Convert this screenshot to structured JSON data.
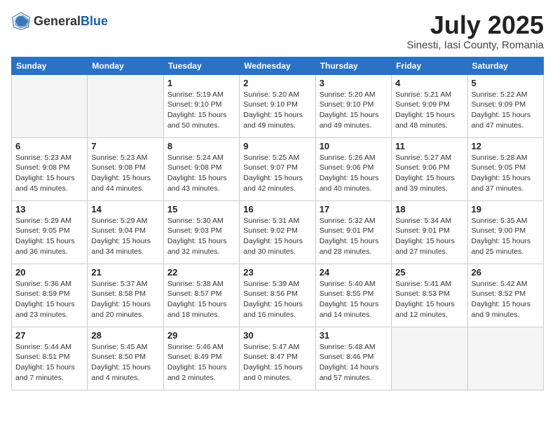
{
  "header": {
    "logo_general": "General",
    "logo_blue": "Blue",
    "month_year": "July 2025",
    "location": "Sinesti, Iasi County, Romania"
  },
  "days_of_week": [
    "Sunday",
    "Monday",
    "Tuesday",
    "Wednesday",
    "Thursday",
    "Friday",
    "Saturday"
  ],
  "weeks": [
    [
      {
        "day": "",
        "info": ""
      },
      {
        "day": "",
        "info": ""
      },
      {
        "day": "1",
        "info": "Sunrise: 5:19 AM\nSunset: 9:10 PM\nDaylight: 15 hours and 50 minutes."
      },
      {
        "day": "2",
        "info": "Sunrise: 5:20 AM\nSunset: 9:10 PM\nDaylight: 15 hours and 49 minutes."
      },
      {
        "day": "3",
        "info": "Sunrise: 5:20 AM\nSunset: 9:10 PM\nDaylight: 15 hours and 49 minutes."
      },
      {
        "day": "4",
        "info": "Sunrise: 5:21 AM\nSunset: 9:09 PM\nDaylight: 15 hours and 48 minutes."
      },
      {
        "day": "5",
        "info": "Sunrise: 5:22 AM\nSunset: 9:09 PM\nDaylight: 15 hours and 47 minutes."
      }
    ],
    [
      {
        "day": "6",
        "info": "Sunrise: 5:23 AM\nSunset: 9:08 PM\nDaylight: 15 hours and 45 minutes."
      },
      {
        "day": "7",
        "info": "Sunrise: 5:23 AM\nSunset: 9:08 PM\nDaylight: 15 hours and 44 minutes."
      },
      {
        "day": "8",
        "info": "Sunrise: 5:24 AM\nSunset: 9:08 PM\nDaylight: 15 hours and 43 minutes."
      },
      {
        "day": "9",
        "info": "Sunrise: 5:25 AM\nSunset: 9:07 PM\nDaylight: 15 hours and 42 minutes."
      },
      {
        "day": "10",
        "info": "Sunrise: 5:26 AM\nSunset: 9:06 PM\nDaylight: 15 hours and 40 minutes."
      },
      {
        "day": "11",
        "info": "Sunrise: 5:27 AM\nSunset: 9:06 PM\nDaylight: 15 hours and 39 minutes."
      },
      {
        "day": "12",
        "info": "Sunrise: 5:28 AM\nSunset: 9:05 PM\nDaylight: 15 hours and 37 minutes."
      }
    ],
    [
      {
        "day": "13",
        "info": "Sunrise: 5:29 AM\nSunset: 9:05 PM\nDaylight: 15 hours and 36 minutes."
      },
      {
        "day": "14",
        "info": "Sunrise: 5:29 AM\nSunset: 9:04 PM\nDaylight: 15 hours and 34 minutes."
      },
      {
        "day": "15",
        "info": "Sunrise: 5:30 AM\nSunset: 9:03 PM\nDaylight: 15 hours and 32 minutes."
      },
      {
        "day": "16",
        "info": "Sunrise: 5:31 AM\nSunset: 9:02 PM\nDaylight: 15 hours and 30 minutes."
      },
      {
        "day": "17",
        "info": "Sunrise: 5:32 AM\nSunset: 9:01 PM\nDaylight: 15 hours and 28 minutes."
      },
      {
        "day": "18",
        "info": "Sunrise: 5:34 AM\nSunset: 9:01 PM\nDaylight: 15 hours and 27 minutes."
      },
      {
        "day": "19",
        "info": "Sunrise: 5:35 AM\nSunset: 9:00 PM\nDaylight: 15 hours and 25 minutes."
      }
    ],
    [
      {
        "day": "20",
        "info": "Sunrise: 5:36 AM\nSunset: 8:59 PM\nDaylight: 15 hours and 23 minutes."
      },
      {
        "day": "21",
        "info": "Sunrise: 5:37 AM\nSunset: 8:58 PM\nDaylight: 15 hours and 20 minutes."
      },
      {
        "day": "22",
        "info": "Sunrise: 5:38 AM\nSunset: 8:57 PM\nDaylight: 15 hours and 18 minutes."
      },
      {
        "day": "23",
        "info": "Sunrise: 5:39 AM\nSunset: 8:56 PM\nDaylight: 15 hours and 16 minutes."
      },
      {
        "day": "24",
        "info": "Sunrise: 5:40 AM\nSunset: 8:55 PM\nDaylight: 15 hours and 14 minutes."
      },
      {
        "day": "25",
        "info": "Sunrise: 5:41 AM\nSunset: 8:53 PM\nDaylight: 15 hours and 12 minutes."
      },
      {
        "day": "26",
        "info": "Sunrise: 5:42 AM\nSunset: 8:52 PM\nDaylight: 15 hours and 9 minutes."
      }
    ],
    [
      {
        "day": "27",
        "info": "Sunrise: 5:44 AM\nSunset: 8:51 PM\nDaylight: 15 hours and 7 minutes."
      },
      {
        "day": "28",
        "info": "Sunrise: 5:45 AM\nSunset: 8:50 PM\nDaylight: 15 hours and 4 minutes."
      },
      {
        "day": "29",
        "info": "Sunrise: 5:46 AM\nSunset: 8:49 PM\nDaylight: 15 hours and 2 minutes."
      },
      {
        "day": "30",
        "info": "Sunrise: 5:47 AM\nSunset: 8:47 PM\nDaylight: 15 hours and 0 minutes."
      },
      {
        "day": "31",
        "info": "Sunrise: 5:48 AM\nSunset: 8:46 PM\nDaylight: 14 hours and 57 minutes."
      },
      {
        "day": "",
        "info": ""
      },
      {
        "day": "",
        "info": ""
      }
    ]
  ]
}
